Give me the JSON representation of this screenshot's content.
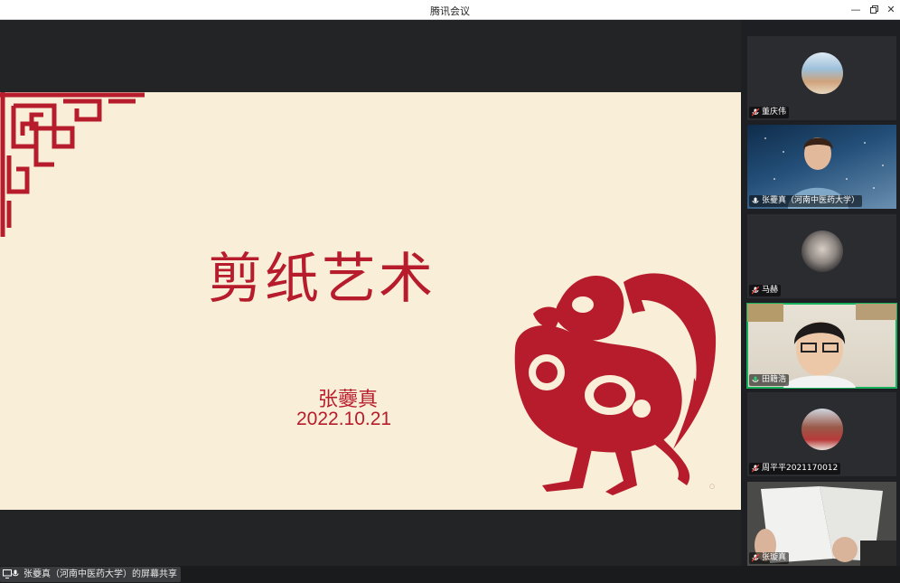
{
  "window": {
    "title": "腾讯会议"
  },
  "slide": {
    "title": "剪纸艺术",
    "author": "张虁真",
    "date": "2022.10.21",
    "accent_color": "#b71c2c",
    "background_color": "#f9efd9"
  },
  "status": {
    "share_label": "张虁真（河南中医药大学）的屏幕共享"
  },
  "participants": [
    {
      "name": "董庆伟",
      "mic": "muted",
      "video": false
    },
    {
      "name": "张虁真（河南中医药大学）",
      "mic": "on",
      "video": true
    },
    {
      "name": "马赫",
      "mic": "muted",
      "video": false
    },
    {
      "name": "田籍浩",
      "mic": "speaking",
      "video": true
    },
    {
      "name": "周平平2021170012",
      "mic": "muted",
      "video": false
    },
    {
      "name": "张璇真",
      "mic": "muted",
      "video": true
    }
  ],
  "icons": [
    "minimize-icon",
    "restore-icon",
    "close-icon",
    "screen-share-icon",
    "microphone-icon",
    "mic-muted-icon"
  ]
}
